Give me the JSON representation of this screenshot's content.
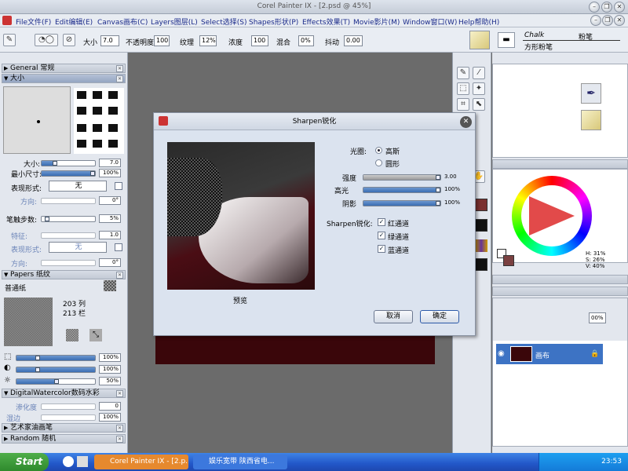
{
  "window": {
    "title": "Corel Painter IX - [2.psd @ 45%]"
  },
  "menu": [
    "File文件(F)",
    "Edit编辑(E)",
    "Canvas画布(C)",
    "Layers图层(L)",
    "Select选择(S)",
    "Shapes形状(P)",
    "Effects效果(T)",
    "Movie影片(M)",
    "Window窗口(W)",
    "Help帮助(H)"
  ],
  "propbar": {
    "size_label": "大小",
    "size_value": "7.0",
    "opacity_label": "不透明度",
    "opacity_value": "100",
    "grain_label": "纹理",
    "grain_value": "12%",
    "resat_label": "浓度",
    "resat_value": "100",
    "bleed_label": "混合",
    "bleed_value": "0%",
    "jitter_label": "抖动",
    "jitter_value": "0.00",
    "brush_category": "Chalk",
    "brush_category_cn": "粉笔",
    "brush_variant": "方形粉笔"
  },
  "left": {
    "general": "General 常规",
    "size_section": "大小",
    "size_label": "大小:",
    "size_value": "7.0",
    "minsize_label": "最小尺寸:",
    "minsize_value": "100%",
    "expr_label": "表现形式:",
    "expr_value": "无",
    "dir_label": "方向:",
    "dir_value": "0°",
    "step_label": "笔触步数:",
    "step_value": "5%",
    "feature_label": "特征:",
    "feature_value": "1.0",
    "expr2_label": "表现形式:",
    "expr2_value": "无",
    "dir2_label": "方向:",
    "dir2_value": "0°",
    "papers": "Papers 纸纹",
    "paper_name": "普通纸",
    "cols": "203 列",
    "rows": "213 栏",
    "paper_v1": "100%",
    "paper_v2": "100%",
    "paper_v3": "50%",
    "dwc": "DigitalWatercolor数码水彩",
    "diffuse_label": "渗化度",
    "diffuse_value": "0",
    "wet_label": "湿边",
    "wet_value": "100%",
    "artist_oils": "艺术家油画笔",
    "random": "Random 随机"
  },
  "dialog": {
    "title": "Sharpen锐化",
    "preview_label": "预览",
    "aperture_label": "光圈:",
    "gaussian": "高斯",
    "circular": "圆形",
    "amount_label": "强度",
    "amount_value": "3.00",
    "highlight_label": "高光",
    "highlight_value": "100%",
    "shadow_label": "阴影",
    "shadow_value": "100%",
    "sharpen_label": "Sharpen锐化:",
    "red": "红通道",
    "green": "绿通道",
    "blue": "蓝通道",
    "cancel": "取消",
    "ok": "确定"
  },
  "right": {
    "hsv_h": "H: 31%",
    "hsv_s": "S: 26%",
    "hsv_v": "V: 40%",
    "layer_name": "画布",
    "layer_pct": "00%"
  },
  "taskbar": {
    "start": "Start",
    "task1": "Corel Painter IX - [2.p...",
    "task2": "娱乐宽带 陕西省电...",
    "time": "23:53"
  }
}
